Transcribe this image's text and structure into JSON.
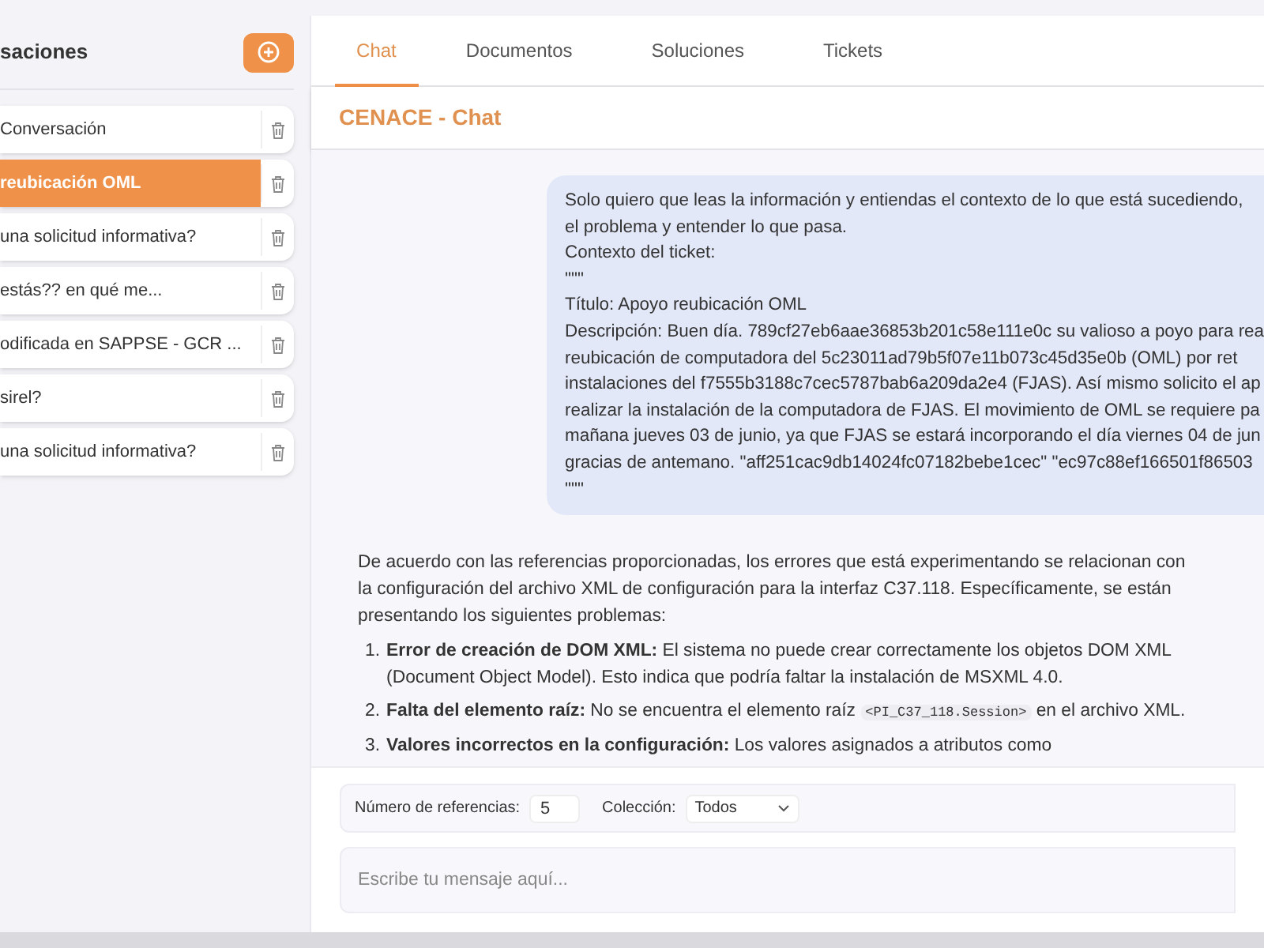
{
  "sidebar": {
    "title": "saciones",
    "items": [
      {
        "label": "Conversación",
        "selected": false
      },
      {
        "label": "reubicación OML",
        "selected": true
      },
      {
        "label": "una solicitud informativa?",
        "selected": false
      },
      {
        "label": "estás?? en qué me...",
        "selected": false
      },
      {
        "label": "odificada en SAPPSE - GCR ...",
        "selected": false
      },
      {
        "label": "sirel?",
        "selected": false
      },
      {
        "label": "una solicitud informativa?",
        "selected": false
      }
    ]
  },
  "tabs": [
    {
      "label": "Chat",
      "selected": true
    },
    {
      "label": "Documentos",
      "selected": false
    },
    {
      "label": "Soluciones",
      "selected": false
    },
    {
      "label": "Tickets",
      "selected": false
    }
  ],
  "chat_title": "CENACE - Chat",
  "messages": [
    {
      "kind": "user",
      "lines": [
        "Solo quiero que leas la información y entiendas el contexto de lo que está sucediendo,",
        "el problema y entender lo que pasa.",
        "Contexto del ticket:",
        "\"\"\"",
        "Título: Apoyo reubicación OML",
        "Descripción: Buen día. 789cf27eb6aae36853b201c58e111e0c su valioso a poyo para rea",
        "reubicación de computadora del 5c23011ad79b5f07e11b073c45d35e0b (OML) por ret",
        "instalaciones del f7555b3188c7cec5787bab6a209da2e4 (FJAS). Así mismo solicito el ap",
        "realizar la instalación de la computadora de FJAS. El movimiento de OML se requiere pa",
        "mañana jueves 03 de junio, ya que FJAS se estará incorporando el día viernes 04 de jun",
        "gracias de antemano. \"aff251cac9db14024fc07182bebe1cec\" \"ec97c88ef166501f86503",
        "\"\"\""
      ]
    },
    {
      "kind": "assistant",
      "intro": "De acuerdo con las referencias proporcionadas, los errores que está experimentando se relacionan con la configuración del archivo XML de configuración para la interfaz C37.118. Específicamente, se están presentando los siguientes problemas:",
      "list": [
        {
          "number": "1.",
          "text": "**Error de creación de DOM XML:** El sistema no puede crear correctamente los objetos DOM XML (Document Object Model). Esto indica que podría faltar la instalación de MSXML 4.0."
        },
        {
          "number": "2.",
          "text": "**Falta del elemento raíz:** No se encuentra el elemento raíz",
          "code": "<PI_C37_118.Session>",
          "text_after": "en el archivo XML."
        },
        {
          "number": "3.",
          "text": "**Valores incorrectos en la configuración:** Los valores asignados a atributos como"
        }
      ]
    }
  ],
  "options": {
    "references_label": "Número de referencias:",
    "references_value": "5",
    "collection_label": "Colección:",
    "collection_value": "Todos"
  },
  "composer": {
    "placeholder": "Escribe tu mensaje aquí..."
  }
}
